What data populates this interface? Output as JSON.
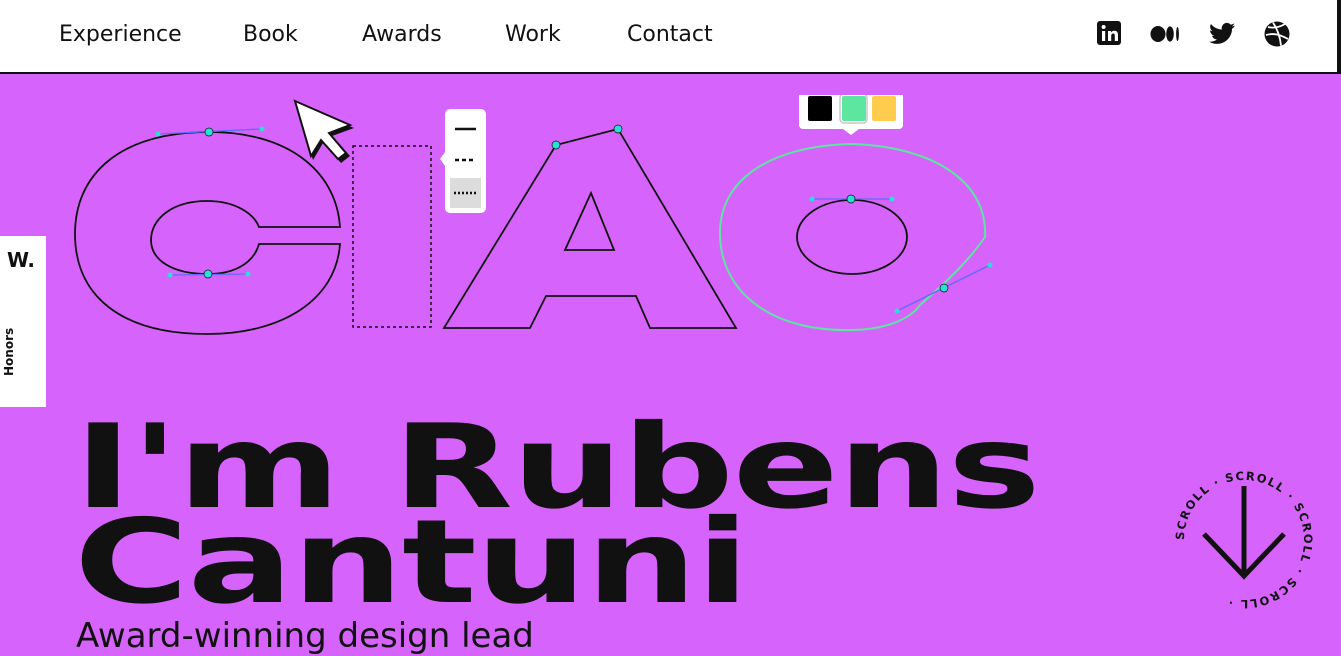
{
  "nav": {
    "items": [
      "Experience",
      "Book",
      "Awards",
      "Work",
      "Contact"
    ]
  },
  "social": {
    "linkedin_icon": "linkedin-icon",
    "medium_icon": "medium-icon",
    "twitter_icon": "twitter-icon",
    "dribbble_icon": "dribbble-icon"
  },
  "side_badge": {
    "logo": "W.",
    "label": "Honors"
  },
  "hero": {
    "art_word": "CIAO",
    "headline_line1": "I'm Rubens",
    "headline_line2": "Cantuni",
    "subheadline": "Award-winning design lead"
  },
  "scroll": {
    "ring_text": "SCROLL · SCROLL · SCROLL · SCROLL · "
  },
  "colors": {
    "background": "#d663fb",
    "swatch_black": "#000000",
    "swatch_green": "#5ce6a0",
    "swatch_yellow": "#ffcc4d",
    "node_cyan": "#28e0d6"
  }
}
